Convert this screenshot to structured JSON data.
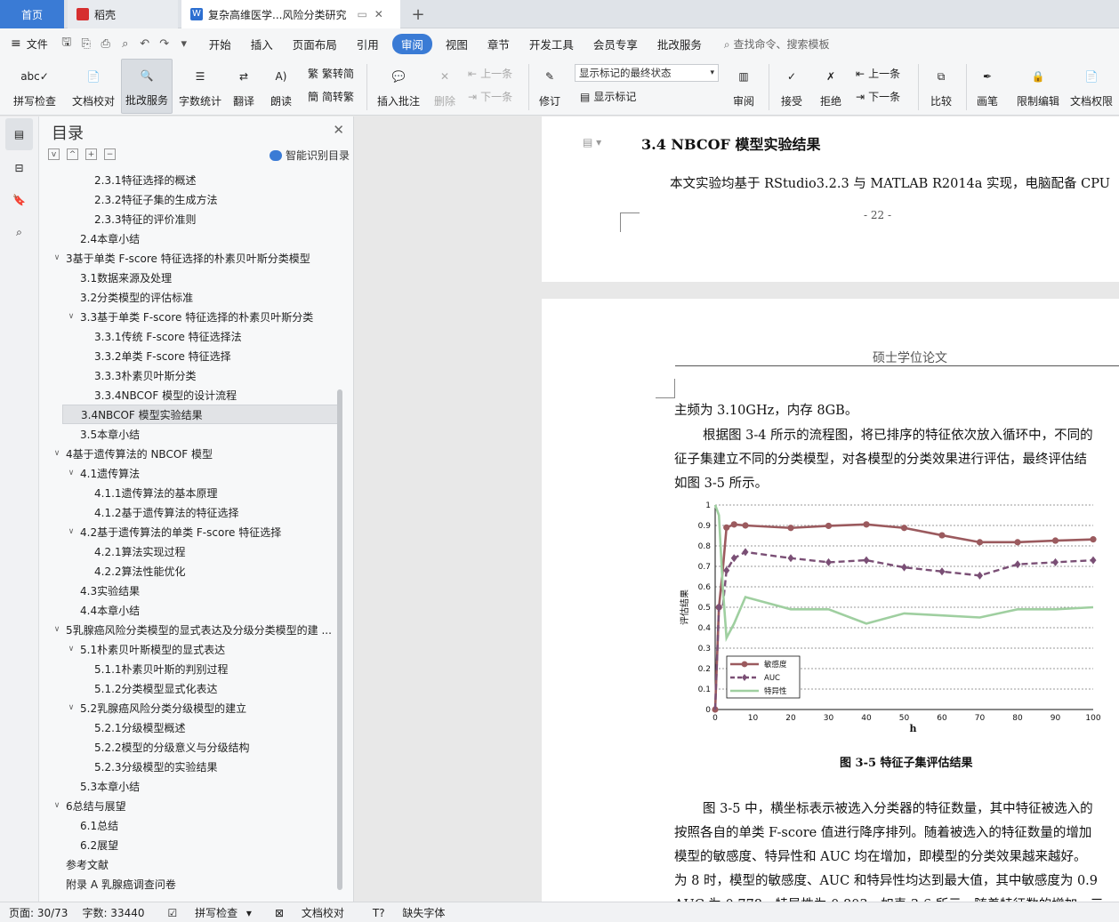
{
  "tabs": {
    "home": "首页",
    "daoke": "稻壳",
    "doc": "复杂高维医学...风险分类研究"
  },
  "menu": {
    "file": "文件",
    "items": [
      "开始",
      "插入",
      "页面布局",
      "引用",
      "审阅",
      "视图",
      "章节",
      "开发工具",
      "会员专享",
      "批改服务"
    ],
    "search": "查找命令、搜索模板"
  },
  "ribbon": {
    "spell": "拼写检查",
    "doccheck": "文档校对",
    "review_service": "批改服务",
    "wordcount": "字数统计",
    "translate": "翻译",
    "read": "朗读",
    "trad": "繁转简",
    "simp": "简转繁",
    "insert_comment": "插入批注",
    "delete": "删除",
    "prev": "上一条",
    "next": "下一条",
    "track": "修订",
    "show_state": "显示标记的最终状态",
    "show_markup": "显示标记",
    "review": "审阅",
    "accept": "接受",
    "reject": "拒绝",
    "prev2": "上一条",
    "next2": "下一条",
    "compare": "比较",
    "pen": "画笔",
    "restrict": "限制编辑",
    "permission": "文档权限"
  },
  "toc": {
    "title": "目录",
    "smart": "智能识别目录",
    "items": [
      {
        "t": "2.3.1特征选择的概述",
        "l": 3,
        "a": ""
      },
      {
        "t": "2.3.2特征子集的生成方法",
        "l": 3,
        "a": ""
      },
      {
        "t": "2.3.3特征的评价准则",
        "l": 3,
        "a": ""
      },
      {
        "t": "2.4本章小结",
        "l": 2,
        "a": ""
      },
      {
        "t": "3基于单类 F-score 特征选择的朴素贝叶斯分类模型",
        "l": 1,
        "a": "v"
      },
      {
        "t": "3.1数据来源及处理",
        "l": 2,
        "a": ""
      },
      {
        "t": "3.2分类模型的评估标准",
        "l": 2,
        "a": ""
      },
      {
        "t": "3.3基于单类 F-score 特征选择的朴素贝叶斯分类",
        "l": 2,
        "a": "v"
      },
      {
        "t": "3.3.1传统 F-score 特征选择法",
        "l": 3,
        "a": ""
      },
      {
        "t": "3.3.2单类 F-score 特征选择",
        "l": 3,
        "a": ""
      },
      {
        "t": "3.3.3朴素贝叶斯分类",
        "l": 3,
        "a": ""
      },
      {
        "t": "3.3.4NBCOF 模型的设计流程",
        "l": 3,
        "a": ""
      },
      {
        "t": "3.4NBCOF 模型实验结果",
        "l": 2,
        "a": "",
        "sel": true
      },
      {
        "t": "3.5本章小结",
        "l": 2,
        "a": ""
      },
      {
        "t": "4基于遗传算法的 NBCOF 模型",
        "l": 1,
        "a": "v"
      },
      {
        "t": "4.1遗传算法",
        "l": 2,
        "a": "v"
      },
      {
        "t": "4.1.1遗传算法的基本原理",
        "l": 3,
        "a": ""
      },
      {
        "t": "4.1.2基于遗传算法的特征选择",
        "l": 3,
        "a": ""
      },
      {
        "t": "4.2基于遗传算法的单类 F-score 特征选择",
        "l": 2,
        "a": "v"
      },
      {
        "t": "4.2.1算法实现过程",
        "l": 3,
        "a": ""
      },
      {
        "t": "4.2.2算法性能优化",
        "l": 3,
        "a": ""
      },
      {
        "t": "4.3实验结果",
        "l": 2,
        "a": ""
      },
      {
        "t": "4.4本章小结",
        "l": 2,
        "a": ""
      },
      {
        "t": "5乳腺癌风险分类模型的显式表达及分级分类模型的建 ...",
        "l": 1,
        "a": "v"
      },
      {
        "t": "5.1朴素贝叶斯模型的显式表达",
        "l": 2,
        "a": "v"
      },
      {
        "t": "5.1.1朴素贝叶斯的判别过程",
        "l": 3,
        "a": ""
      },
      {
        "t": "5.1.2分类模型显式化表达",
        "l": 3,
        "a": ""
      },
      {
        "t": "5.2乳腺癌风险分类分级模型的建立",
        "l": 2,
        "a": "v"
      },
      {
        "t": "5.2.1分级模型概述",
        "l": 3,
        "a": ""
      },
      {
        "t": "5.2.2模型的分级意义与分级结构",
        "l": 3,
        "a": ""
      },
      {
        "t": "5.2.3分级模型的实验结果",
        "l": 3,
        "a": ""
      },
      {
        "t": "5.3本章小结",
        "l": 2,
        "a": ""
      },
      {
        "t": "6总结与展望",
        "l": 1,
        "a": "v"
      },
      {
        "t": "6.1总结",
        "l": 2,
        "a": ""
      },
      {
        "t": "6.2展望",
        "l": 2,
        "a": ""
      },
      {
        "t": "参考文献",
        "l": 1,
        "a": ""
      },
      {
        "t": "附录 A 乳腺癌调查问卷",
        "l": 1,
        "a": ""
      }
    ]
  },
  "doc": {
    "heading": "3.4  NBCOF 模型实验结果",
    "p1": "本文实验均基于 RStudio3.2.3 与 MATLAB R2014a 实现，电脑配备 CPU",
    "page_num": "- 22 -",
    "header": "硕士学位论文",
    "l1": "主频为 3.10GHz，内存 8GB。",
    "l2": "根据图 3-4 所示的流程图，将已排序的特征依次放入循环中，不同的",
    "l3": "征子集建立不同的分类模型，对各模型的分类效果进行评估，最终评估结",
    "l4": "如图 3-5 所示。",
    "caption": "图 3-5  特征子集评估结果",
    "l5": "图 3-5 中，横坐标表示被选入分类器的特征数量，其中特征被选入的",
    "l6": "按照各自的单类 F-score 值进行降序排列。随着被选入的特征数量的增加",
    "l7": "模型的敏感度、特异性和 AUC 均在增加，即模型的分类效果越来越好。",
    "l8": "为 8 时，模型的敏感度、AUC 和特异性均达到最大值，其中敏感度为 0.9",
    "l9": "AUC 为 0.778，特异性为 0.803。如表 3-6 所示，随着特征数的增加，三"
  },
  "chart_data": {
    "type": "line",
    "xlabel": "h",
    "ylabel": "评估结果",
    "xlim": [
      0,
      100
    ],
    "ylim": [
      0,
      1
    ],
    "xticks": [
      0,
      10,
      20,
      30,
      40,
      50,
      60,
      70,
      80,
      90,
      100
    ],
    "yticks": [
      0,
      0.1,
      0.2,
      0.3,
      0.4,
      0.5,
      0.6,
      0.7,
      0.8,
      0.9,
      1
    ],
    "legend": "bottom-left",
    "series": [
      {
        "name": "敏感度",
        "color": "#9b5a5e",
        "style": "solid",
        "marker": "circle",
        "x": [
          0,
          1,
          2,
          3,
          5,
          8,
          20,
          30,
          40,
          50,
          60,
          70,
          80,
          90,
          100
        ],
        "y": [
          0,
          0.5,
          0.68,
          0.89,
          0.905,
          0.9,
          0.888,
          0.898,
          0.905,
          0.888,
          0.852,
          0.818,
          0.818,
          0.826,
          0.832
        ],
        "markers": [
          0,
          1,
          3,
          5,
          8,
          20,
          30,
          40,
          50,
          60,
          70,
          80,
          90,
          100
        ]
      },
      {
        "name": "AUC",
        "color": "#7a4f75",
        "style": "dashed",
        "marker": "diamond",
        "x": [
          0,
          1,
          2,
          3,
          5,
          8,
          20,
          30,
          40,
          50,
          60,
          70,
          80,
          90,
          100
        ],
        "y": [
          0,
          0.5,
          0.5,
          0.68,
          0.74,
          0.77,
          0.74,
          0.72,
          0.73,
          0.695,
          0.675,
          0.655,
          0.71,
          0.72,
          0.73
        ],
        "markers": [
          1,
          3,
          5,
          8,
          20,
          30,
          40,
          50,
          60,
          70,
          80,
          90,
          100
        ]
      },
      {
        "name": "特异性",
        "color": "#9fcfa0",
        "style": "solid",
        "marker": "none",
        "x": [
          0,
          1,
          2,
          3,
          5,
          8,
          20,
          30,
          40,
          50,
          60,
          70,
          80,
          90,
          100
        ],
        "y": [
          1,
          0.95,
          0.6,
          0.35,
          0.42,
          0.55,
          0.49,
          0.49,
          0.42,
          0.47,
          0.46,
          0.45,
          0.49,
          0.49,
          0.5
        ],
        "markers": []
      }
    ]
  },
  "status": {
    "page": "页面: 30/73",
    "words": "字数: 33440",
    "spell": "拼写检查",
    "check": "文档校对",
    "font": "缺失字体"
  }
}
